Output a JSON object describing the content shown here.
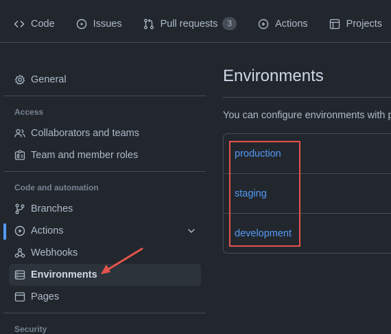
{
  "topnav": {
    "tabs": [
      {
        "label": "Code",
        "icon": "code-icon"
      },
      {
        "label": "Issues",
        "icon": "issue-opened-icon"
      },
      {
        "label": "Pull requests",
        "icon": "git-pull-request-icon",
        "count": "3"
      },
      {
        "label": "Actions",
        "icon": "play-icon"
      },
      {
        "label": "Projects",
        "icon": "table-icon"
      }
    ]
  },
  "sidebar": {
    "general": "General",
    "access_heading": "Access",
    "collaborators": "Collaborators and teams",
    "team_roles": "Team and member roles",
    "code_heading": "Code and automation",
    "branches": "Branches",
    "actions": "Actions",
    "webhooks": "Webhooks",
    "environments": "Environments",
    "pages": "Pages",
    "security_heading": "Security"
  },
  "main": {
    "title": "Environments",
    "description": "You can configure environments with p",
    "environments": [
      "production",
      "staging",
      "development"
    ]
  },
  "colors": {
    "background": "#22272e",
    "link": "#539bf5",
    "annotation": "#e5534b",
    "border": "#444c56"
  }
}
